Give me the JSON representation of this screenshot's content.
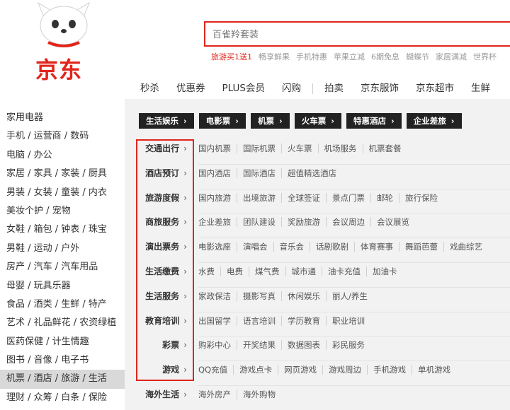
{
  "brand": {
    "logo_text": "京东"
  },
  "search": {
    "placeholder": "百雀羚套装"
  },
  "hot_words": [
    "旅游买1送1",
    "畅享鲜果",
    "手机特惠",
    "苹果立减",
    "6期免息",
    "蝴蝶节",
    "家居满减",
    "世界杯"
  ],
  "nav": [
    "秒杀",
    "优惠券",
    "PLUS会员",
    "闪购",
    "拍卖",
    "京东服饰",
    "京东超市",
    "生鲜"
  ],
  "sidebar": {
    "categories": [
      "家用电器",
      "手机 / 运营商 / 数码",
      "电脑 / 办公",
      "家居 / 家具 / 家装 / 厨具",
      "男装 / 女装 / 童装 / 内衣",
      "美妆个护 / 宠物",
      "女鞋 / 箱包 / 钟表 / 珠宝",
      "男鞋 / 运动 / 户外",
      "房产 / 汽车 / 汽车用品",
      "母婴 / 玩具乐器",
      "食品 / 酒类 / 生鲜 / 特产",
      "艺术 / 礼品鲜花 / 农资绿植",
      "医药保健 / 计生情趣",
      "图书 / 音像 / 电子书",
      "机票 / 酒店 / 旅游 / 生活",
      "理财 / 众筹 / 白条 / 保险"
    ],
    "active_index": 14
  },
  "tags": [
    "生活娱乐",
    "电影票",
    "机票",
    "火车票",
    "特惠酒店",
    "企业差旅"
  ],
  "menu_rows": [
    {
      "title": "交通出行",
      "links": [
        "国内机票",
        "国际机票",
        "火车票",
        "机场服务",
        "机票套餐"
      ]
    },
    {
      "title": "酒店预订",
      "links": [
        "国内酒店",
        "国际酒店",
        "超值精选酒店"
      ]
    },
    {
      "title": "旅游度假",
      "links": [
        "国内旅游",
        "出境旅游",
        "全球签证",
        "景点门票",
        "邮轮",
        "旅行保险"
      ]
    },
    {
      "title": "商旅服务",
      "links": [
        "企业差旅",
        "团队建设",
        "奖励旅游",
        "会议周边",
        "会议展览"
      ]
    },
    {
      "title": "演出票务",
      "links": [
        "电影选座",
        "演唱会",
        "音乐会",
        "话剧歌剧",
        "体育赛事",
        "舞蹈芭蕾",
        "戏曲综艺"
      ]
    },
    {
      "title": "生活缴费",
      "links": [
        "水费",
        "电费",
        "煤气费",
        "城市通",
        "油卡充值",
        "加油卡"
      ]
    },
    {
      "title": "生活服务",
      "links": [
        "家政保洁",
        "摄影写真",
        "休闲娱乐",
        "丽人/养生"
      ]
    },
    {
      "title": "教育培训",
      "links": [
        "出国留学",
        "语言培训",
        "学历教育",
        "职业培训"
      ]
    },
    {
      "title": "彩票",
      "links": [
        "购彩中心",
        "开奖结果",
        "数据图表",
        "彩民服务"
      ]
    },
    {
      "title": "游戏",
      "links": [
        "QQ充值",
        "游戏点卡",
        "网页游戏",
        "游戏周边",
        "手机游戏",
        "单机游戏"
      ]
    },
    {
      "title": "海外生活",
      "links": [
        "海外房产",
        "海外购物"
      ]
    }
  ],
  "colors": {
    "brand_red": "#e1251b",
    "tag_bg": "#222222",
    "panel_bg": "#f2f2f2",
    "active_bg": "#d9d9d9"
  },
  "icons": {
    "arrow": "chevron-right-icon",
    "mascot": "jd-dog-mascot-icon"
  }
}
